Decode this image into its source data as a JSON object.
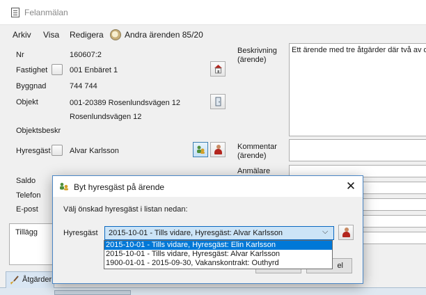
{
  "window": {
    "title": "Felanmälan"
  },
  "menu": {
    "arkiv": "Arkiv",
    "visa": "Visa",
    "redigera": "Redigera",
    "other_errands": "Andra ärenden 85/20"
  },
  "form": {
    "nr": {
      "label": "Nr",
      "value": "160607:2"
    },
    "fastighet": {
      "label": "Fastighet",
      "value": "001 Enbäret 1"
    },
    "byggnad": {
      "label": "Byggnad",
      "value": "744 744"
    },
    "objekt": {
      "label": "Objekt",
      "value_line1": "001-20389 Rosenlundsvägen 12",
      "value_line2": "Rosenlundsvägen 12"
    },
    "objektsbeskr": {
      "label": "Objektsbeskr"
    },
    "hyresgast": {
      "label": "Hyresgäst",
      "value": "Alvar Karlsson"
    },
    "saldo": {
      "label": "Saldo"
    },
    "telefon": {
      "label": "Telefon"
    },
    "epost": {
      "label": "E-post"
    },
    "tillagg": {
      "label": "Tillägg"
    }
  },
  "right": {
    "beskrivning_label_1": "Beskrivning",
    "beskrivning_label_2": "(ärende)",
    "beskrivning_value": "Ett ärende med tre åtgärder där två av de",
    "kommentar_label_1": "Kommentar",
    "kommentar_label_2": "(ärende)",
    "anmalare_label": "Anmälare"
  },
  "tabs": {
    "atgarder": "Åtgärder"
  },
  "dialog": {
    "title": "Byt hyresgäst på ärende",
    "instruction": "Välj önskad hyresgäst i listan nedan:",
    "hyresgast_label": "Hyresgäst",
    "selected_value": "2015-10-01 - Tills vidare, Hyresgäst: Alvar Karlsson",
    "options": [
      "2015-10-01 - Tills vidare, Hyresgäst: Elin Karlsson",
      "2015-10-01 - Tills vidare, Hyresgäst: Alvar Karlsson",
      "1900-01-01 - 2015-09-30, Vakanskontrakt: Outhyrd"
    ],
    "highlighted_option_index": 0,
    "ok_label": "",
    "cancel_label_visible": "el"
  },
  "colors": {
    "accent": "#0078d7",
    "combo_highlight": "#cce4f7",
    "tab_background": "#d9e6f3",
    "dialog_border": "#4a86c5"
  }
}
